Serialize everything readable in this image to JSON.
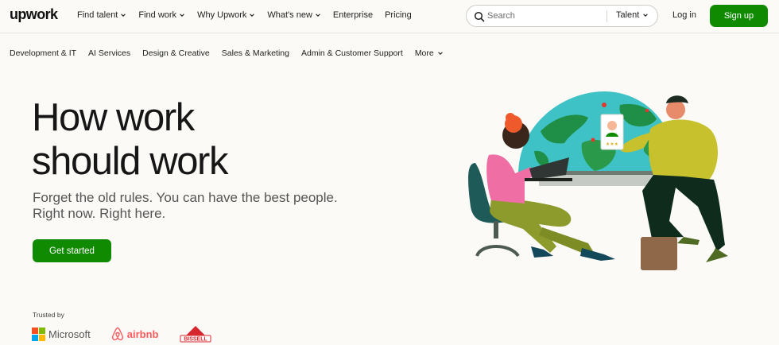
{
  "header": {
    "logo": "upwork",
    "nav": [
      {
        "label": "Find talent",
        "dropdown": true
      },
      {
        "label": "Find work",
        "dropdown": true
      },
      {
        "label": "Why Upwork",
        "dropdown": true
      },
      {
        "label": "What's new",
        "dropdown": true
      },
      {
        "label": "Enterprise",
        "dropdown": false
      },
      {
        "label": "Pricing",
        "dropdown": false
      }
    ],
    "search": {
      "placeholder": "Search",
      "scope": "Talent"
    },
    "login": "Log in",
    "signup": "Sign up"
  },
  "categories": [
    "Development & IT",
    "AI Services",
    "Design & Creative",
    "Sales & Marketing",
    "Admin & Customer Support"
  ],
  "more_label": "More",
  "hero": {
    "title_line1": "How work",
    "title_line2": "should work",
    "subtitle_line1": "Forget the old rules. You can have the best people.",
    "subtitle_line2": "Right now. Right here.",
    "cta": "Get started"
  },
  "trusted": {
    "label": "Trusted by",
    "brands": [
      "Microsoft",
      "airbnb",
      "BISSELL"
    ]
  },
  "colors": {
    "accent": "#108a00",
    "airbnb": "#ff5a5f",
    "bissell": "#d7272e"
  }
}
